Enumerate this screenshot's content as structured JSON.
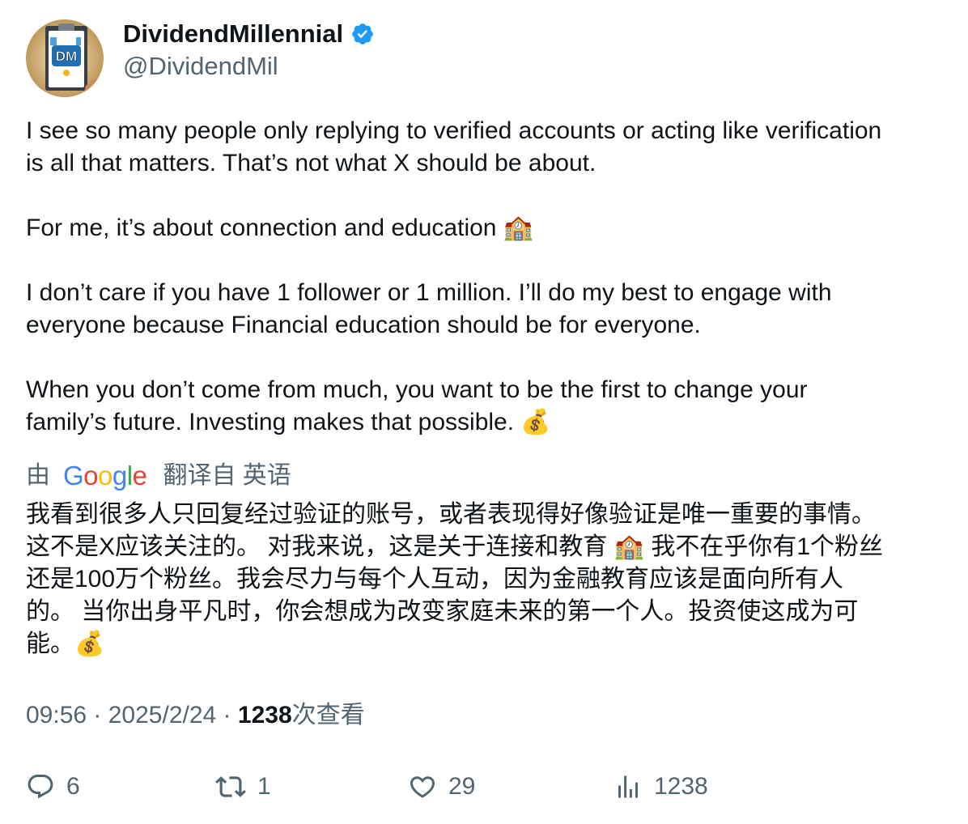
{
  "user": {
    "display_name": "DividendMillennial",
    "handle": "@DividendMil",
    "avatar_text": "DM",
    "verified_icon": "verified-badge-icon"
  },
  "tweet": {
    "paragraphs": [
      "I see so many people only replying to verified accounts or acting like verification\nis all that matters. That’s not what X should be about.",
      "For me, it’s about connection and education 🏫",
      "I don’t care if you have 1 follower or 1 million.  I’ll do my best to engage with\neveryone because Financial education should be for everyone.",
      "When you don’t come from much, you want to be the first to change your\nfamily’s future. Investing makes that possible. 💰"
    ]
  },
  "translation": {
    "by_label": "由",
    "provider": "Google",
    "from_label": "翻译自 英语",
    "text": "我看到很多人只回复经过验证的账号，或者表现得好像验证是唯一重要的事情。\n这不是X应该关注的。 对我来说，这是关于连接和教育 🏫 我不在乎你有1个粉丝\n还是100万个粉丝。我会尽力与每个人互动，因为金融教育应该是面向所有人\n的。 当你出身平凡时，你会想成为改变家庭未来的第一个人。投资使这成为可\n能。💰"
  },
  "meta": {
    "time": "09:56",
    "separator": " · ",
    "date": "2025/2/24",
    "views_count": "1238",
    "views_label": "次查看"
  },
  "actions": {
    "reply": {
      "icon": "reply-icon",
      "count": "6"
    },
    "retweet": {
      "icon": "retweet-icon",
      "count": "1"
    },
    "like": {
      "icon": "heart-icon",
      "count": "29"
    },
    "views": {
      "icon": "bar-chart-icon",
      "count": "1238"
    }
  },
  "colors": {
    "text_primary": "#0f1419",
    "text_secondary": "#536471",
    "verified_blue": "#1d9bf0",
    "background": "#ffffff"
  }
}
